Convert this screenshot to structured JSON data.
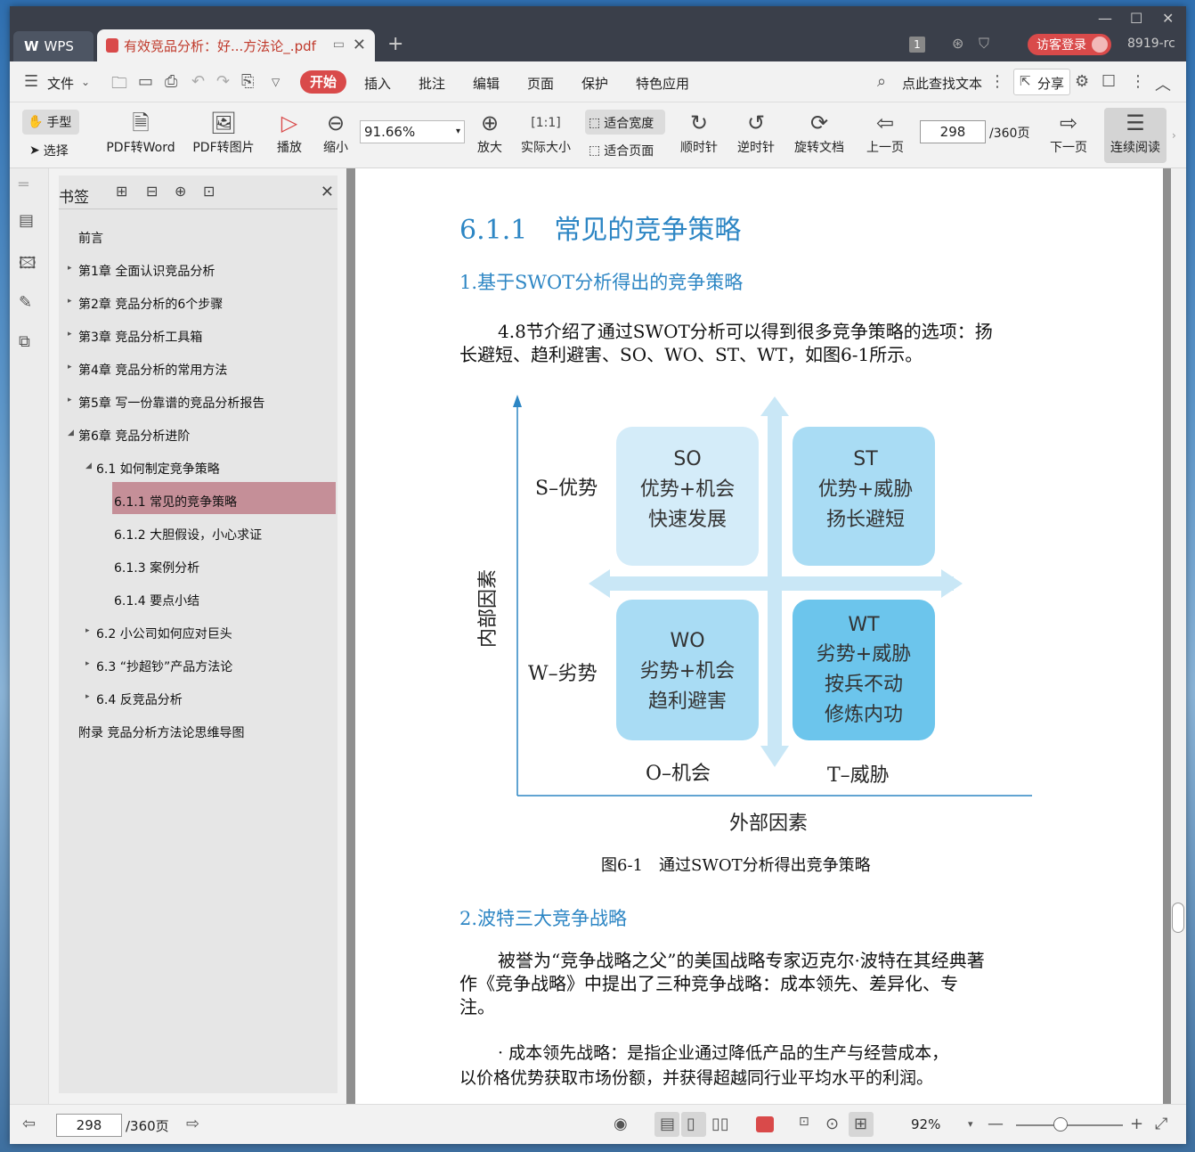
{
  "titlebar": {
    "app_tab": "WPS",
    "doc_tab_title": "有效竞品分析：好...方法论_.pdf",
    "badge_count": "1",
    "login_label": "访客登录",
    "version": "8919-rc"
  },
  "menu": {
    "file": "文件",
    "start": "开始",
    "insert": "插入",
    "comment": "批注",
    "edit": "编辑",
    "page": "页面",
    "protect": "保护",
    "special": "特色应用",
    "search": "点此查找文本",
    "share": "分享"
  },
  "toolbar": {
    "hand": "手型",
    "select": "选择",
    "pdf_to_word": "PDF转Word",
    "pdf_to_image": "PDF转图片",
    "play": "播放",
    "zoom_out": "缩小",
    "zoom_value": "91.66%",
    "zoom_in": "放大",
    "actual_size": "实际大小",
    "fit_width": "适合宽度",
    "fit_page": "适合页面",
    "clockwise": "顺时针",
    "counterclockwise": "逆时针",
    "rotate_doc": "旋转文档",
    "prev_page": "上一页",
    "page_current": "298",
    "page_total": "/360页",
    "next_page": "下一页",
    "continuous": "连续阅读"
  },
  "bookmarks": {
    "title": "书签",
    "items": [
      {
        "label": "前言",
        "level": 0,
        "arrow": ""
      },
      {
        "label": "第1章 全面认识竞品分析",
        "level": 0,
        "arrow": "▸"
      },
      {
        "label": "第2章 竞品分析的6个步骤",
        "level": 0,
        "arrow": "▸"
      },
      {
        "label": "第3章 竞品分析工具箱",
        "level": 0,
        "arrow": "▸"
      },
      {
        "label": "第4章 竞品分析的常用方法",
        "level": 0,
        "arrow": "▸"
      },
      {
        "label": "第5章 写一份靠谱的竞品分析报告",
        "level": 0,
        "arrow": "▸"
      },
      {
        "label": "第6章 竞品分析进阶",
        "level": 0,
        "arrow": "◢"
      },
      {
        "label": "6.1 如何制定竞争策略",
        "level": 1,
        "arrow": "◢"
      },
      {
        "label": "6.1.1 常见的竞争策略",
        "level": 2,
        "arrow": ""
      },
      {
        "label": "6.1.2 大胆假设，小心求证",
        "level": 2,
        "arrow": ""
      },
      {
        "label": "6.1.3 案例分析",
        "level": 2,
        "arrow": ""
      },
      {
        "label": "6.1.4 要点小结",
        "level": 2,
        "arrow": ""
      },
      {
        "label": "6.2 小公司如何应对巨头",
        "level": 1,
        "arrow": "▸"
      },
      {
        "label": "6.3 “抄超钞”产品方法论",
        "level": 1,
        "arrow": "▸"
      },
      {
        "label": "6.4 反竞品分析",
        "level": 1,
        "arrow": "▸"
      },
      {
        "label": "附录 竞品分析方法论思维导图",
        "level": 0,
        "arrow": ""
      }
    ]
  },
  "document": {
    "heading": "6.1.1　常见的竞争策略",
    "sub1": "1.基于SWOT分析得出的竞争策略",
    "p1_line1": "4.8节介绍了通过SWOT分析可以得到很多竞争策略的选项：扬",
    "p1_line2": "长避短、趋利避害、SO、WO、ST、WT，如图6-1所示。",
    "diagram": {
      "so": [
        "SO",
        "优势+机会",
        "快速发展"
      ],
      "st": [
        "ST",
        "优势+威胁",
        "扬长避短"
      ],
      "wo": [
        "WO",
        "劣势+机会",
        "趋利避害"
      ],
      "wt": [
        "WT",
        "劣势+威胁",
        "按兵不动",
        "修炼内功"
      ],
      "s_label": "S–优势",
      "w_label": "W–劣势",
      "o_label": "O–机会",
      "t_label": "T–威胁",
      "y_axis": "内部因素",
      "x_axis": "外部因素",
      "colors": {
        "light": "#d4ecf9",
        "mid": "#a9dcf4",
        "dark": "#6cc5ec",
        "arrow": "#c9e7f6",
        "axis": "#2d86c4"
      }
    },
    "caption": "图6-1　通过SWOT分析得出竞争策略",
    "sub2": "2.波特三大竞争战略",
    "p2_line1": "被誉为“竞争战略之父”的美国战略专家迈克尔·波特在其经典著",
    "p2_line2": "作《竞争战略》中提出了三种竞争战略：成本领先、差异化、专",
    "p2_line3": "注。",
    "p3_line1": "· 成本领先战略：是指企业通过降低产品的生产与经营成本，",
    "p3_line2": "以价格优势获取市场份额，并获得超越同行业平均水平的利润。"
  },
  "statusbar": {
    "page_current": "298",
    "page_total": "/360页",
    "zoom": "92%"
  }
}
